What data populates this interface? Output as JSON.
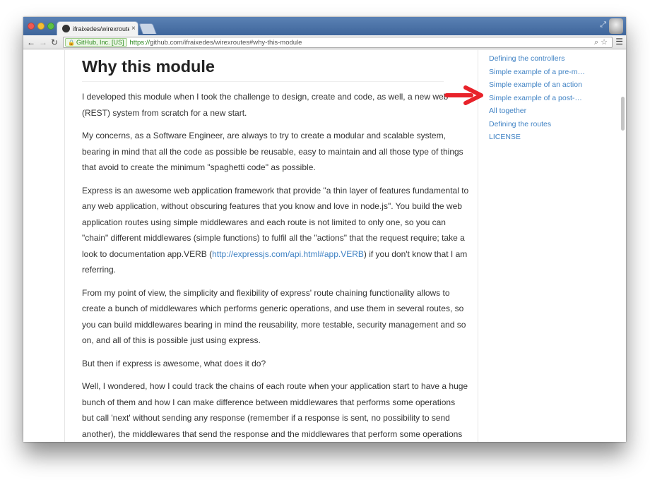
{
  "browser": {
    "tab_title": "ifraixedes/wirexroutes - C",
    "tab_close": "×",
    "security_badge": "GitHub, Inc. [US]",
    "url_protocol": "https://",
    "url_rest": "github.com/ifraixedes/wirexroutes#why-this-module"
  },
  "article": {
    "heading": "Why this module",
    "p1": "I developed this module when I took the challenge to design, create and code, as well, a new web (REST) system from scratch for a new start.",
    "p2": "My concerns, as a Software Engineer, are always to try to create a modular and scalable system, bearing in mind that all the code as possible be reusable, easy to maintain and all those type of things that avoid to create the minimum \"spaghetti code\" as possible.",
    "p3_before": "Express is an awesome web application framework that provide \"a thin layer of features fundamental to any web application, without obscuring features that you know and love in node.js\". You build the web application routes using simple middlewares and each route is not limited to only one, so you can \"chain\" different middlewares (simple functions) to fulfil all the \"actions\" that the request require; take a look to documentation app.VERB (",
    "p3_link": "http://expressjs.com/api.html#app.VERB",
    "p3_after": ") if you don't know that I am referring.",
    "p4": "From my point of view, the simplicity and flexibility of express' route chaining functionality allows to create a bunch of middlewares which performs generic operations, and use them in several routes, so you can build middlewares bearing in mind the reusability, more testable, security management and so on, and all of this is possible just using express.",
    "p5": "But then if express is awesome, what does it do?",
    "p6": "Well, I wondered, how I could track the chains of each route when your application start to have a huge bunch of them and how I can make difference between middlewares that performs some operations but call 'next' without sending any response (remember if a response is sent, no possibility to send another), the middlewares that send the response and the middlewares that perform some operations after sending a response (i.e. logging operations, etc). I replied myself, building this module as a helper organise them."
  },
  "toc": {
    "items": [
      "Defining the controllers",
      "Simple example of a pre-m…",
      "Simple example of an action",
      "Simple example of a post-…",
      "All together",
      "Defining the routes",
      "LICENSE"
    ]
  },
  "colors": {
    "link": "#4183c4",
    "arrow": "#e8222a",
    "titlebar": "#4a70a6"
  }
}
